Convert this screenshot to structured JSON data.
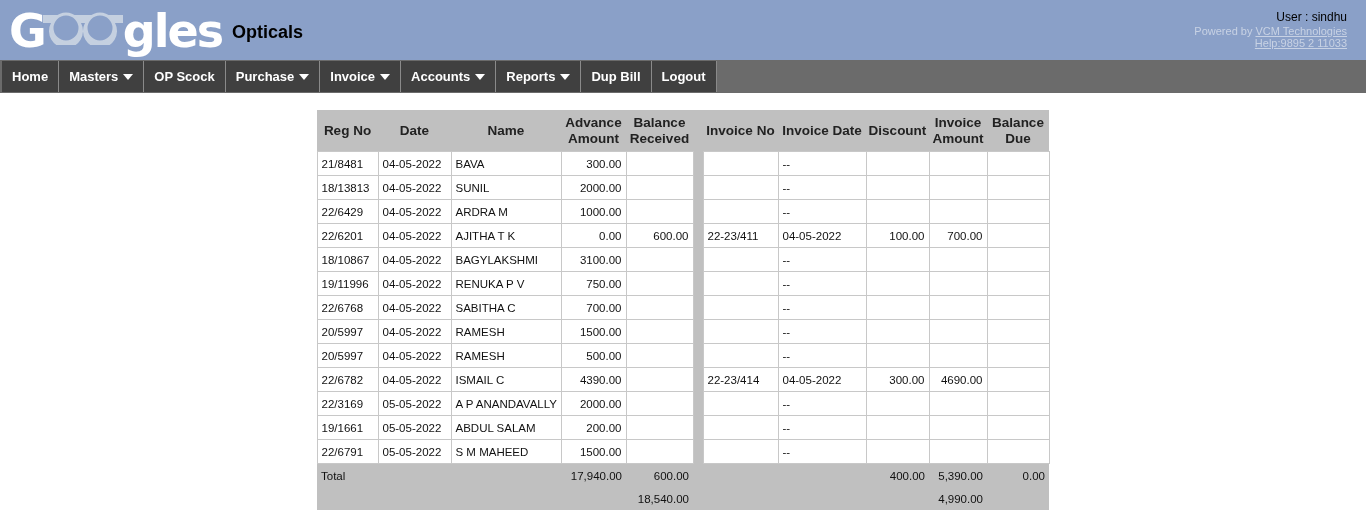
{
  "header": {
    "logo_start": "G",
    "logo_end": "gles",
    "brand_suffix": "Opticals",
    "user": "User : sindhu",
    "powered_by": "Powered by",
    "powered_link": "VCM Technologies",
    "help_link": "Help:9895 2 11033"
  },
  "nav": [
    {
      "label": "Home",
      "has_menu": false
    },
    {
      "label": "Masters",
      "has_menu": true
    },
    {
      "label": "OP Scock",
      "has_menu": false
    },
    {
      "label": "Purchase",
      "has_menu": true
    },
    {
      "label": "Invoice",
      "has_menu": true
    },
    {
      "label": "Accounts",
      "has_menu": true
    },
    {
      "label": "Reports",
      "has_menu": true
    },
    {
      "label": "Dup Bill",
      "has_menu": false
    },
    {
      "label": "Logout",
      "has_menu": false
    }
  ],
  "table": {
    "columns": [
      "Reg No",
      "Date",
      "Name",
      "Advance Amount",
      "Balance Received",
      "Invoice No",
      "Invoice Date",
      "Discount",
      "Invoice Amount",
      "Balance Due"
    ],
    "rows": [
      [
        "21/8481",
        "04-05-2022",
        "BAVA",
        "300.00",
        null,
        null,
        "--",
        null,
        null,
        null
      ],
      [
        "18/13813",
        "04-05-2022",
        "SUNIL",
        "2000.00",
        null,
        null,
        "--",
        null,
        null,
        null
      ],
      [
        "22/6429",
        "04-05-2022",
        "ARDRA M",
        "1000.00",
        null,
        null,
        "--",
        null,
        null,
        null
      ],
      [
        "22/6201",
        "04-05-2022",
        "AJITHA T K",
        "0.00",
        "600.00",
        "22-23/411",
        "04-05-2022",
        "100.00",
        "700.00",
        null
      ],
      [
        "18/10867",
        "04-05-2022",
        "BAGYLAKSHMI",
        "3100.00",
        null,
        null,
        "--",
        null,
        null,
        null
      ],
      [
        "19/11996",
        "04-05-2022",
        "RENUKA P V",
        "750.00",
        null,
        null,
        "--",
        null,
        null,
        null
      ],
      [
        "22/6768",
        "04-05-2022",
        "SABITHA C",
        "700.00",
        null,
        null,
        "--",
        null,
        null,
        null
      ],
      [
        "20/5997",
        "04-05-2022",
        "RAMESH",
        "1500.00",
        null,
        null,
        "--",
        null,
        null,
        null
      ],
      [
        "20/5997",
        "04-05-2022",
        "RAMESH",
        "500.00",
        null,
        null,
        "--",
        null,
        null,
        null
      ],
      [
        "22/6782",
        "04-05-2022",
        "ISMAIL C",
        "4390.00",
        null,
        "22-23/414",
        "04-05-2022",
        "300.00",
        "4690.00",
        null
      ],
      [
        "22/3169",
        "05-05-2022",
        "A P ANANDAVALLY",
        "2000.00",
        null,
        null,
        "--",
        null,
        null,
        null
      ],
      [
        "19/1661",
        "05-05-2022",
        "ABDUL SALAM",
        "200.00",
        null,
        null,
        "--",
        null,
        null,
        null
      ],
      [
        "22/6791",
        "05-05-2022",
        "S M MAHEED",
        "1500.00",
        null,
        null,
        "--",
        null,
        null,
        null
      ]
    ],
    "totals": [
      {
        "label": "Total",
        "advance_amount": "17,940.00",
        "balance_received": "600.00",
        "discount": "400.00",
        "invoice_amount": "5,390.00",
        "balance_due": "0.00"
      },
      {
        "balance_received": "18,540.00",
        "invoice_amount": "4,990.00"
      }
    ]
  }
}
